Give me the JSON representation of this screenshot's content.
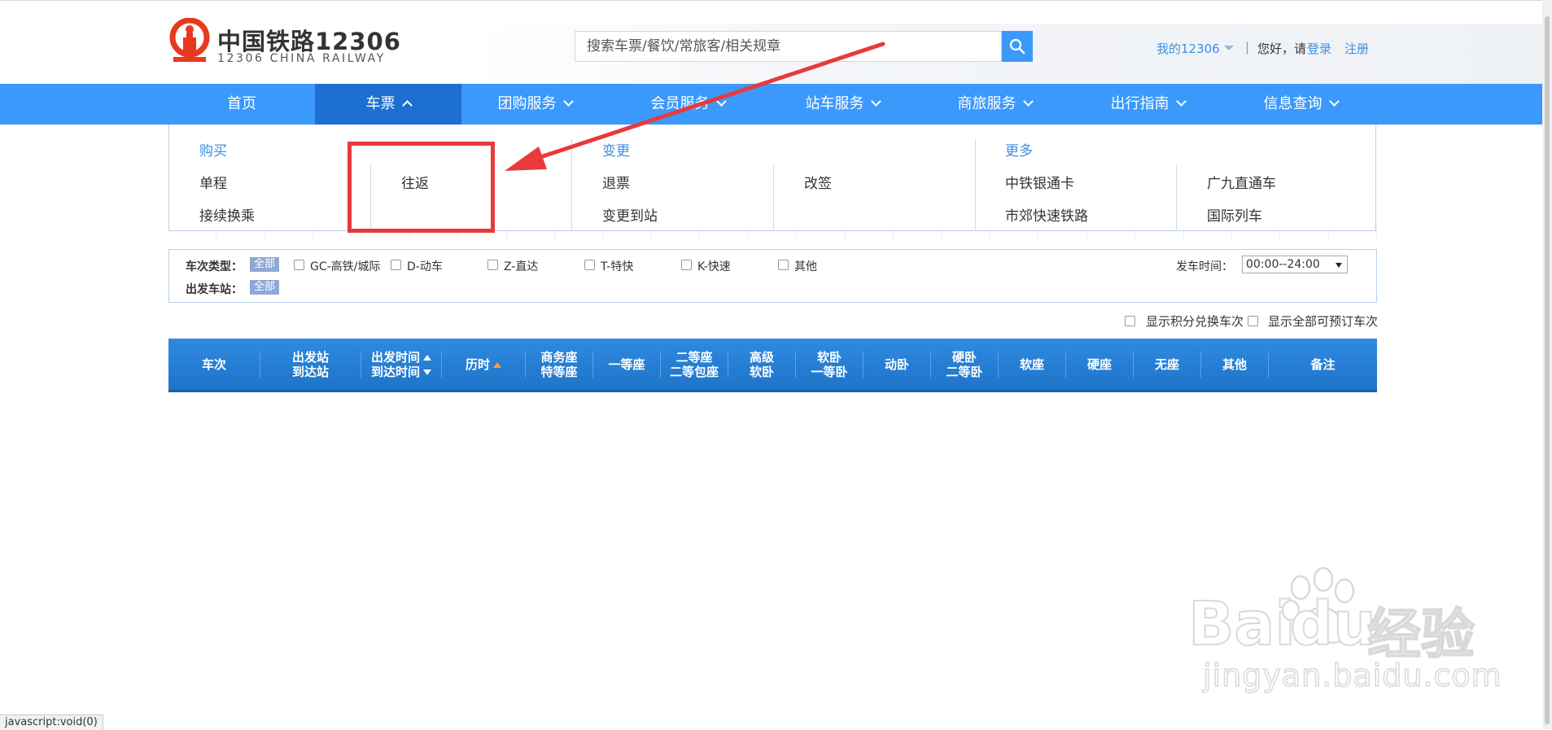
{
  "header": {
    "logo_cn": "中国铁路12306",
    "logo_en": "12306 CHINA RAILWAY",
    "search_placeholder": "搜索车票/餐饮/常旅客/相关规章",
    "my12306": "我的12306",
    "separator": "|",
    "greeting": "您好，请",
    "login": "登录",
    "register": "注册"
  },
  "nav": {
    "items": [
      {
        "label": "首页"
      },
      {
        "label": "车票"
      },
      {
        "label": "团购服务"
      },
      {
        "label": "会员服务"
      },
      {
        "label": "站车服务"
      },
      {
        "label": "商旅服务"
      },
      {
        "label": "出行指南"
      },
      {
        "label": "信息查询"
      }
    ]
  },
  "dropdown": {
    "buy": {
      "heading": "购买",
      "items": [
        "单程",
        "往返",
        "接续换乘"
      ]
    },
    "change": {
      "heading": "变更",
      "items": [
        "退票",
        "改签",
        "变更到站"
      ]
    },
    "more": {
      "heading": "更多",
      "items": [
        "中铁银通卡",
        "广九直通车",
        "市郊快速铁路",
        "国际列车"
      ]
    }
  },
  "filter": {
    "train_type_label": "车次类型：",
    "all_tag": "全部",
    "types": [
      "GC-高铁/城际",
      "D-动车",
      "Z-直达",
      "T-特快",
      "K-快速",
      "其他"
    ],
    "depart_station_label": "出发车站：",
    "depart_all_tag": "全部",
    "time_label": "发车时间：",
    "time_value": "00:00--24:00"
  },
  "options": {
    "points_exchange": "显示积分兑换车次",
    "show_all_bookable": "显示全部可预订车次"
  },
  "table_header": {
    "cols": [
      {
        "l1": "车次",
        "l2": ""
      },
      {
        "l1": "出发站",
        "l2": "到达站"
      },
      {
        "l1": "出发时间",
        "l2": "到达时间"
      },
      {
        "l1": "历时",
        "l2": ""
      },
      {
        "l1": "商务座",
        "l2": "特等座"
      },
      {
        "l1": "一等座",
        "l2": ""
      },
      {
        "l1": "二等座",
        "l2": "二等包座"
      },
      {
        "l1": "高级",
        "l2": "软卧"
      },
      {
        "l1": "软卧",
        "l2": "一等卧"
      },
      {
        "l1": "动卧",
        "l2": ""
      },
      {
        "l1": "硬卧",
        "l2": "二等卧"
      },
      {
        "l1": "软座",
        "l2": ""
      },
      {
        "l1": "硬座",
        "l2": ""
      },
      {
        "l1": "无座",
        "l2": ""
      },
      {
        "l1": "其他",
        "l2": ""
      },
      {
        "l1": "备注",
        "l2": ""
      }
    ]
  },
  "status_bar": "javascript:void(0)",
  "watermark": {
    "brand": "Bai",
    "brand2": "du",
    "cn": "经验",
    "url": "jingyan.baidu.com"
  },
  "colors": {
    "brand_red": "#e8381e",
    "nav_blue": "#3b99fc",
    "nav_active": "#1d6fd1",
    "link_blue": "#3b8fe6",
    "annotation_red": "#e83a3a"
  }
}
